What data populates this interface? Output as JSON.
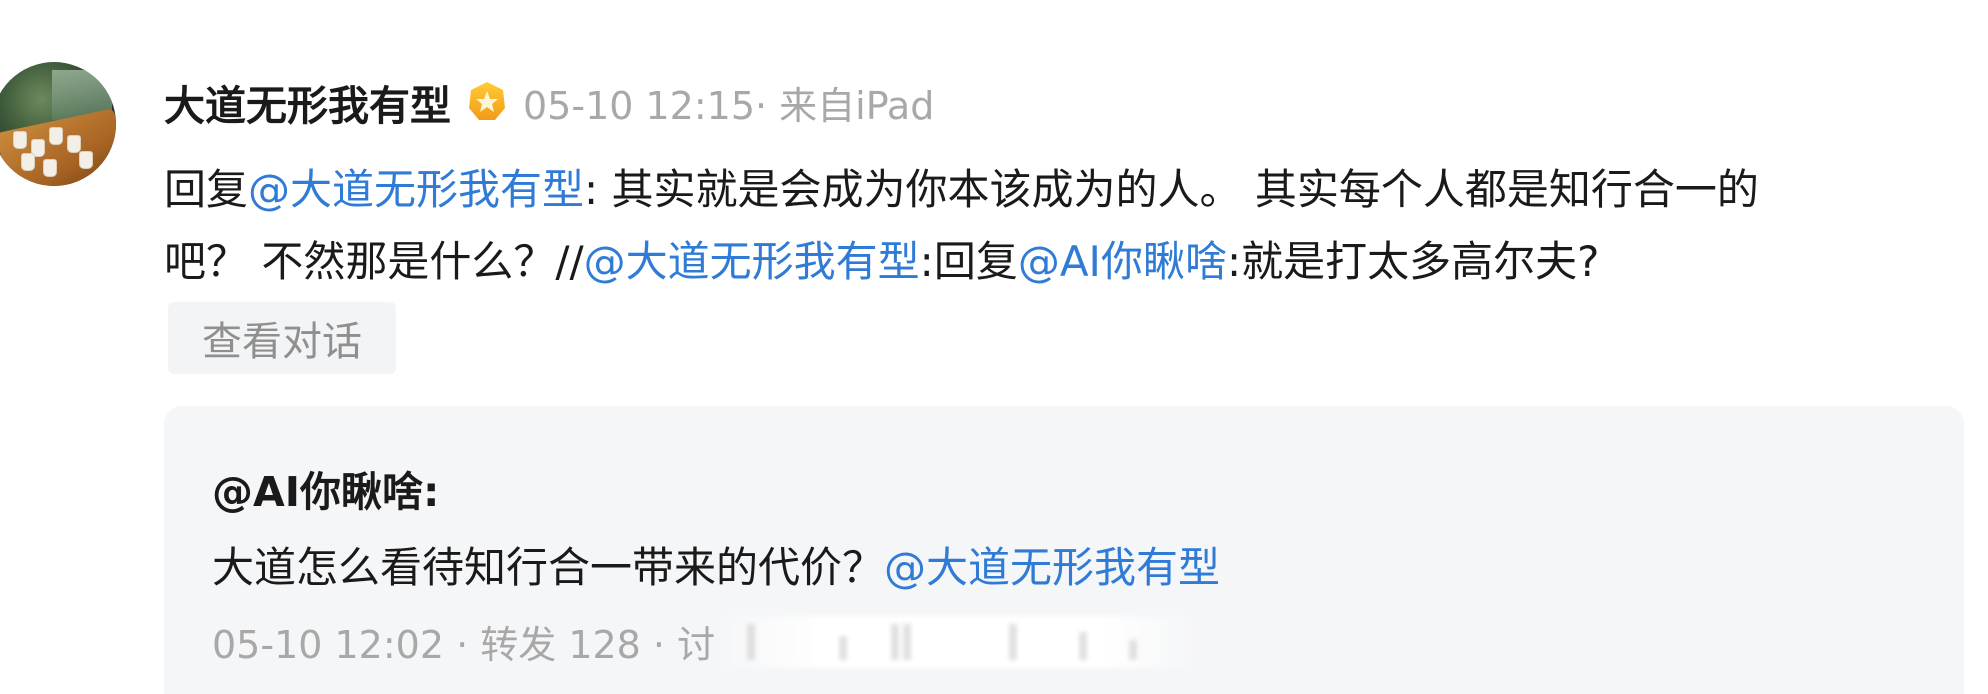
{
  "post": {
    "username": "大道无形我有型",
    "meta": "05-10 12:15· 来自iPad",
    "badge_icon": "gold-star-badge-icon",
    "content": {
      "line1": {
        "prefix": "回复",
        "mention1": "@大道无形我有型",
        "text": ": 其实就是会成为你本该成为的人。 其实每个人都是知行合一的"
      },
      "line2": {
        "text1": "吧？ 不然那是什么？//",
        "mention2": "@大道无形我有型",
        "text2": ":回复",
        "mention3": "@AI你瞅啥",
        "text3": ":就是打太多高尔夫?"
      }
    },
    "view_dialog_label": "查看对话"
  },
  "quote": {
    "author": "@AI你瞅啥:",
    "text": "大道怎么看待知行合一带来的代价？",
    "mention": "@大道无形我有型",
    "meta": "05-10 12:02  · 转发 128 · 讨"
  },
  "colors": {
    "mention": "#2f7bd6",
    "meta_gray": "#a8a8a8",
    "card_bg": "#f5f6f8"
  }
}
